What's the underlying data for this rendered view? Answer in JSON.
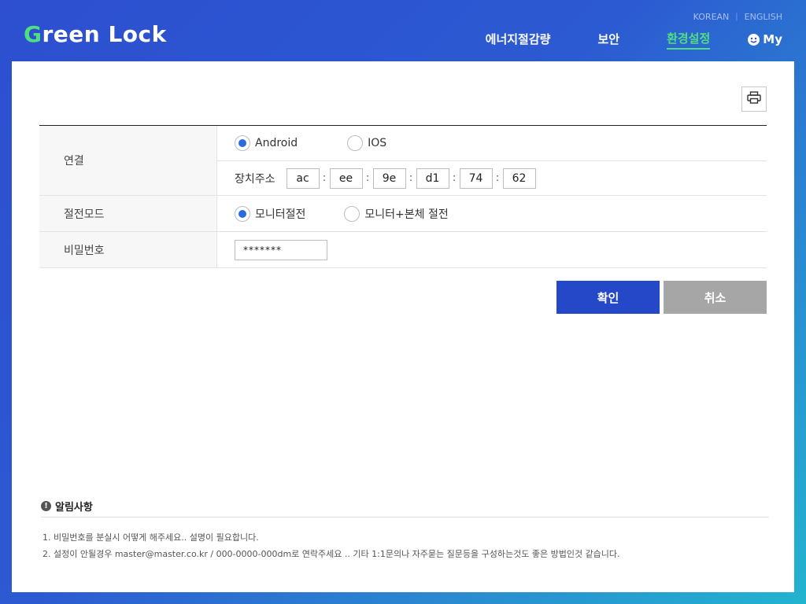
{
  "header": {
    "logo_prefix": "G",
    "logo_rest": "reen Lock",
    "lang": {
      "korean": "KOREAN",
      "separator": "|",
      "english": "ENGLISH"
    },
    "nav": [
      {
        "label": "에너지절감량"
      },
      {
        "label": "보안"
      },
      {
        "label": "환경설정",
        "active": true
      }
    ],
    "my_label": "My"
  },
  "form": {
    "connection": {
      "label": "연결",
      "options": [
        "Android",
        "IOS"
      ],
      "selected": "Android",
      "mac_label": "장치주소",
      "mac": [
        "ac",
        "ee",
        "9e",
        "d1",
        "74",
        "62"
      ],
      "mac_separator": ":"
    },
    "power_mode": {
      "label": "절전모드",
      "options": [
        "모니터절전",
        "모니터+본체 절전"
      ],
      "selected": "모니터절전"
    },
    "password": {
      "label": "비밀번호",
      "value": "*******"
    }
  },
  "buttons": {
    "confirm": "확인",
    "cancel": "취소"
  },
  "notice": {
    "title": "알림사항",
    "items": [
      "1. 비밀번호를 분실시  어떻게 해주세요.. 설명이 필요합니다.",
      "2. 설정이 안될경우 master@master.co.kr / 000-0000-000dm로 연락주세요 .. 기타 1:1문의나 자주묻는 질문등을 구성하는것도 좋은 방법인것 같습니다."
    ]
  },
  "colors": {
    "accent_green": "#4ee07e",
    "primary_blue": "#2548c8",
    "radio_blue": "#2a6be3",
    "cancel_gray": "#a6a6a6"
  },
  "icons": {
    "print": "printer-icon",
    "my": "smiley-icon",
    "notice": "warning-icon"
  }
}
